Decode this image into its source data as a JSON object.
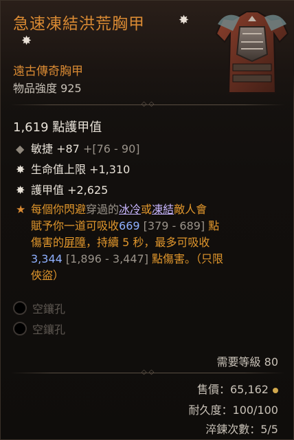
{
  "item": {
    "name": "急速凍結洪荒胸甲",
    "rarity_type": "遠古傳奇胸甲",
    "item_power": "物品強度 925"
  },
  "stats": {
    "armor": "1,619 點護甲值",
    "affixes": [
      {
        "text": "敏捷 +87",
        "range": "+[76 - 90]"
      },
      {
        "text": "生命值上限 +1,310",
        "range": ""
      },
      {
        "text": "護甲值 +2,625",
        "range": ""
      }
    ]
  },
  "legendary": {
    "l1_a": "每個你閃避",
    "l1_b": "穿過的",
    "l1_c": "冰冷",
    "l1_d": "或",
    "l1_e": "凍結",
    "l1_f": "敵人會",
    "l2_a": "賦予你一道可吸收",
    "l2_b": "669",
    "l2_c": "[379 - 689]",
    "l2_d": "點",
    "l3_a": "傷害的",
    "l3_b": "屏障",
    "l3_c": "，持續 5 秒，最多可吸收",
    "l4_a": "3,344",
    "l4_b": "[1,896 - 3,447]",
    "l4_c": "點傷害。（只限",
    "l5": "俠盜）"
  },
  "sockets": [
    "空鑲孔",
    "空鑲孔"
  ],
  "requirements": {
    "level": "需要等級 80"
  },
  "footer": {
    "sell_price": "售價：65,162",
    "durability": "耐久度：100/100",
    "tempers": "淬鍊次數：5/5"
  },
  "colors": {
    "title_orange": "#d98a33",
    "legendary_text": "#e0962c",
    "value_blue": "#8fb0ff",
    "ice_purple": "#c9b7ff"
  },
  "icons": [
    "legendary-star-icon",
    "chest-armor-icon",
    "affix-diamond-icon",
    "affix-star-icon",
    "gem-socket-icon",
    "gold-coin-icon"
  ]
}
